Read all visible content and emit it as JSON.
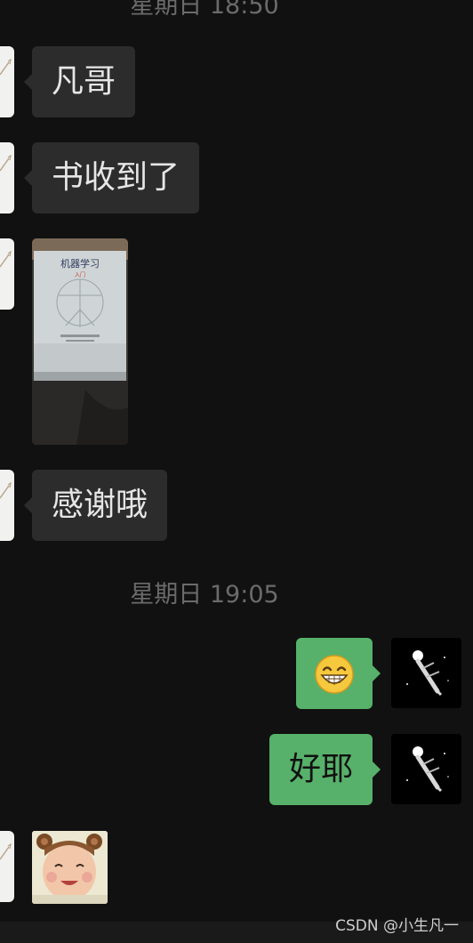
{
  "timestamps": {
    "first": "星期日 18:50",
    "second": "星期日 19:05"
  },
  "messages": {
    "m1": "凡哥",
    "m2": "书收到了",
    "m4": "感谢哦",
    "m6": "好耶"
  },
  "photo": {
    "book_title": "机器学习",
    "book_badge": "入门"
  },
  "watermark": "CSDN @小生凡一",
  "colors": {
    "background": "#111111",
    "bubble_incoming": "#2c2c2c",
    "bubble_outgoing": "#57b16a",
    "timestamp_text": "#6b6b6b"
  },
  "icons": {
    "incoming_avatar": "sketch-avatar-icon",
    "outgoing_avatar": "astronaut-avatar-icon",
    "emoji": "grinning-face-emoji"
  }
}
